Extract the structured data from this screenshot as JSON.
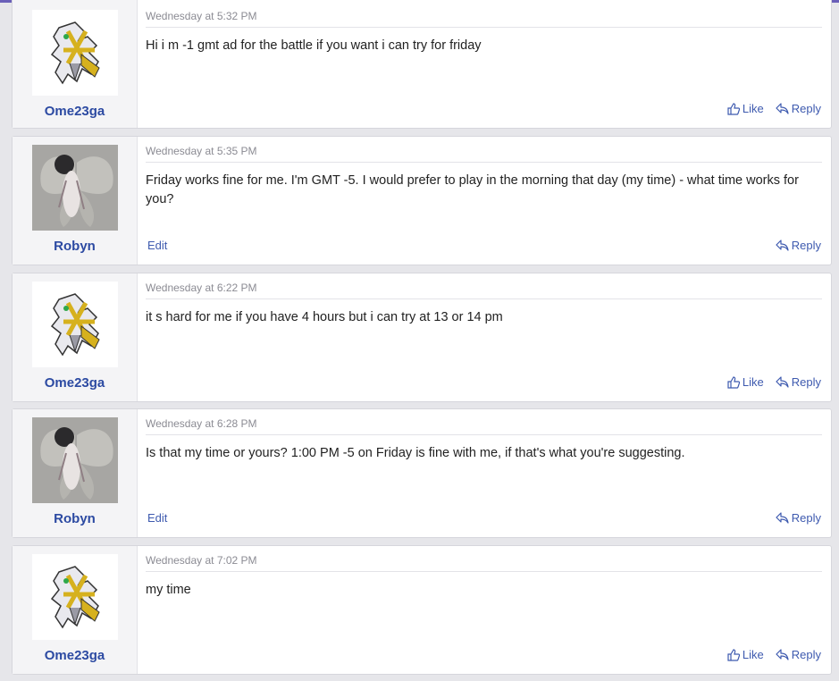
{
  "posts": [
    {
      "author": "Ome23ga",
      "avatar": "arceus-avatar",
      "timestamp": "Wednesday at 5:32 PM",
      "message": "Hi i m -1 gmt ad for the battle if you want i can try for friday",
      "actions": {
        "like": "Like",
        "reply": "Reply"
      }
    },
    {
      "author": "Robyn",
      "avatar": "moth-fairy-avatar",
      "timestamp": "Wednesday at 5:35 PM",
      "message": "Friday works fine for me. I'm GMT -5. I would prefer to play in the morning that day (my time) - what time works for you?",
      "actions": {
        "edit": "Edit",
        "reply": "Reply"
      }
    },
    {
      "author": "Ome23ga",
      "avatar": "arceus-avatar",
      "timestamp": "Wednesday at 6:22 PM",
      "message": "it s hard for me if you have 4 hours but i can try at 13 or 14 pm",
      "actions": {
        "like": "Like",
        "reply": "Reply"
      }
    },
    {
      "author": "Robyn",
      "avatar": "moth-fairy-avatar",
      "timestamp": "Wednesday at 6:28 PM",
      "message": "Is that my time or yours? 1:00 PM -5 on Friday is fine with me, if that's what you're suggesting.",
      "actions": {
        "edit": "Edit",
        "reply": "Reply"
      }
    },
    {
      "author": "Ome23ga",
      "avatar": "arceus-avatar",
      "timestamp": "Wednesday at 7:02 PM",
      "message": "my time",
      "actions": {
        "like": "Like",
        "reply": "Reply"
      }
    }
  ],
  "colors": {
    "accent": "#3e5aaf",
    "username": "#2c4aa2",
    "topbar": "#6a5fb8"
  }
}
